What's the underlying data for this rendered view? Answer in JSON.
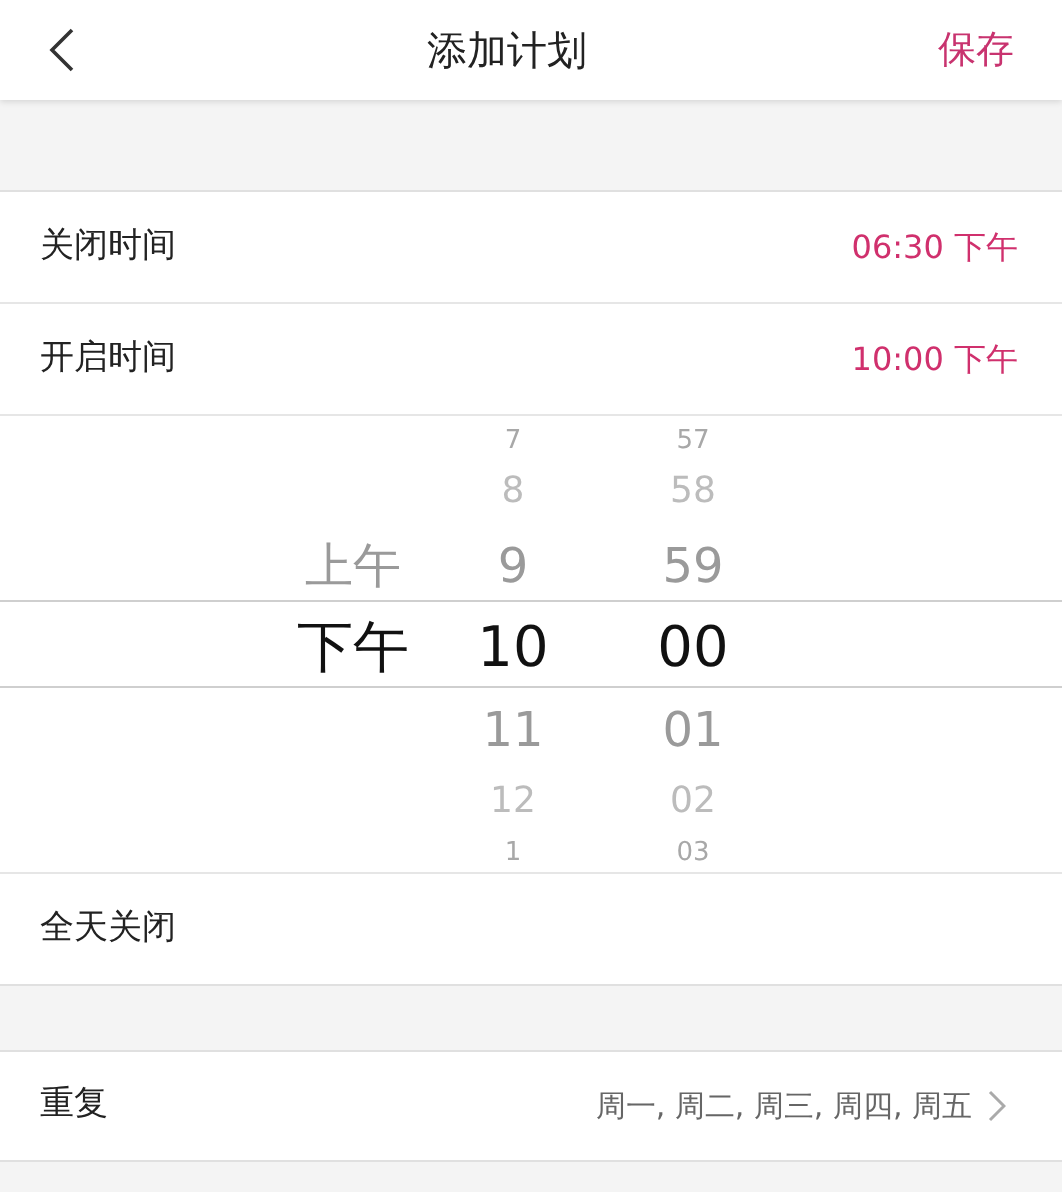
{
  "header": {
    "title": "添加计划",
    "save": "保存"
  },
  "times": [
    {
      "label": "关闭时间",
      "value": "06:30 下午"
    },
    {
      "label": "开启时间",
      "value": "10:00 下午"
    }
  ],
  "picker": {
    "columns": [
      {
        "items": [
          {
            "text": "上午",
            "selected": false
          },
          {
            "text": "下午",
            "selected": true
          }
        ]
      },
      {
        "items": [
          {
            "text": "7",
            "selected": false
          },
          {
            "text": "8",
            "selected": false
          },
          {
            "text": "9",
            "selected": false
          },
          {
            "text": "10",
            "selected": true
          },
          {
            "text": "11",
            "selected": false
          },
          {
            "text": "12",
            "selected": false
          },
          {
            "text": "1",
            "selected": false
          }
        ]
      },
      {
        "items": [
          {
            "text": "57",
            "selected": false
          },
          {
            "text": "58",
            "selected": false
          },
          {
            "text": "59",
            "selected": false
          },
          {
            "text": "00",
            "selected": true
          },
          {
            "text": "01",
            "selected": false
          },
          {
            "text": "02",
            "selected": false
          },
          {
            "text": "03",
            "selected": false
          }
        ]
      }
    ]
  },
  "all_day": {
    "label": "全天关闭"
  },
  "repeat": {
    "label": "重复",
    "value": "周一, 周二, 周三, 周四, 周五"
  }
}
